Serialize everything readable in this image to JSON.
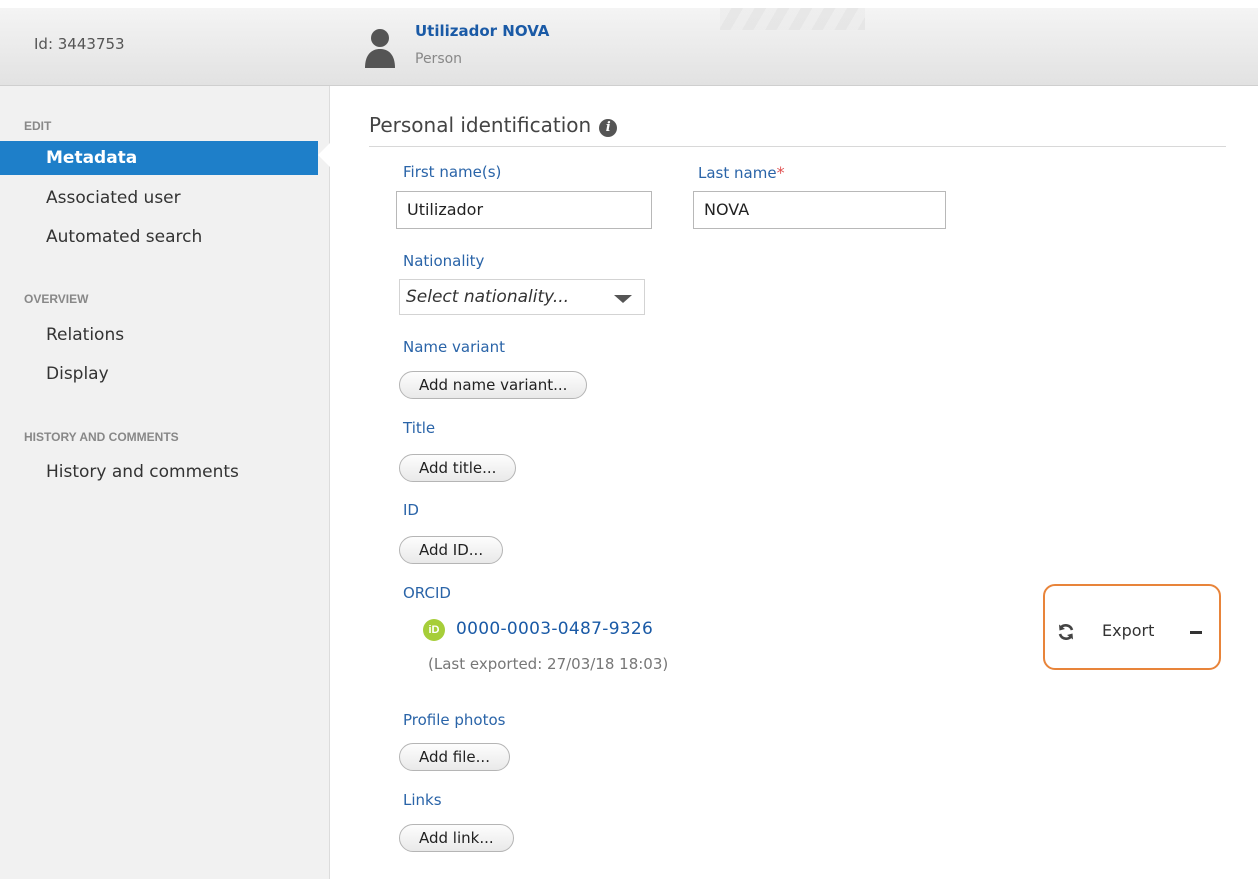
{
  "header": {
    "id_text": "Id: 3443753",
    "person_name": "Utilizador NOVA",
    "person_type": "Person"
  },
  "sidebar": {
    "sections": [
      {
        "title": "EDIT",
        "items": [
          "Metadata",
          "Associated user",
          "Automated search"
        ]
      },
      {
        "title": "OVERVIEW",
        "items": [
          "Relations",
          "Display"
        ]
      },
      {
        "title": "HISTORY AND COMMENTS",
        "items": [
          "History and comments"
        ]
      }
    ],
    "active_item": "Metadata"
  },
  "main": {
    "section_title": "Personal identification",
    "first_name": {
      "label": "First name(s)",
      "value": "Utilizador"
    },
    "last_name": {
      "label": "Last name",
      "required_mark": "*",
      "value": "NOVA"
    },
    "nationality": {
      "label": "Nationality",
      "placeholder": "Select nationality..."
    },
    "name_variant": {
      "label": "Name variant",
      "button": "Add name variant..."
    },
    "title": {
      "label": "Title",
      "button": "Add title..."
    },
    "id": {
      "label": "ID",
      "button": "Add ID..."
    },
    "orcid": {
      "label": "ORCID",
      "logo_text": "iD",
      "value": "0000-0003-0487-9326",
      "last_exported": "(Last exported: 27/03/18 18:03)",
      "export_label": "Export"
    },
    "profile_photos": {
      "label": "Profile photos",
      "button": "Add file..."
    },
    "links": {
      "label": "Links",
      "button": "Add link..."
    }
  },
  "colors": {
    "accent": "#1e7fc9",
    "link": "#2a64a8",
    "highlight_border": "#e8843a",
    "orcid_green": "#a6ce39"
  },
  "icons": {
    "person": "person-icon",
    "info": "info-icon",
    "refresh": "refresh-icon",
    "minus": "minus-icon"
  }
}
